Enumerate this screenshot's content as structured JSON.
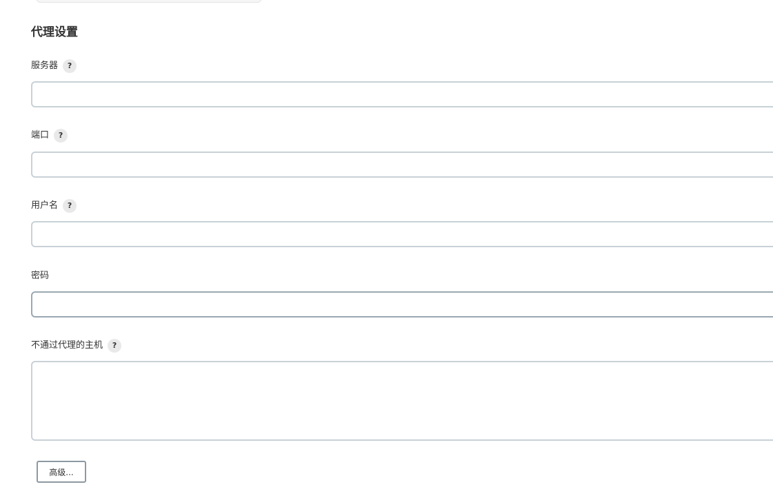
{
  "section": {
    "title": "代理设置"
  },
  "fields": {
    "server": {
      "label": "服务器",
      "value": ""
    },
    "port": {
      "label": "端口",
      "value": ""
    },
    "username": {
      "label": "用户名",
      "value": ""
    },
    "password": {
      "label": "密码",
      "value": ""
    },
    "no_proxy_hosts": {
      "label": "不通过代理的主机",
      "value": ""
    }
  },
  "help_glyph": "?",
  "advanced_button": {
    "label": "高级..."
  },
  "colors": {
    "input_border": "#c8d1d6",
    "input_border_focus": "#9aa8b1",
    "help_bg": "#e9e9e9",
    "button_border": "#8d99a0"
  }
}
